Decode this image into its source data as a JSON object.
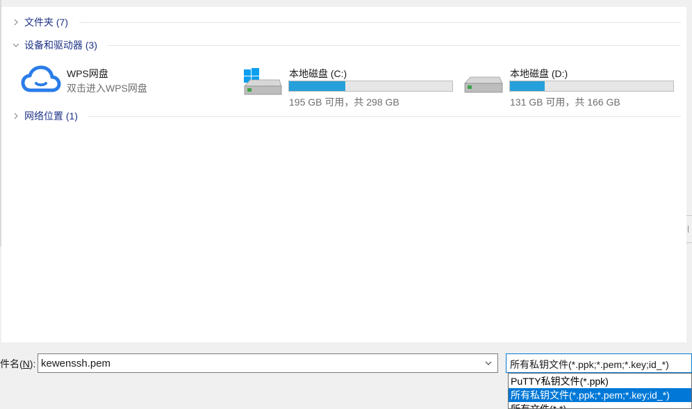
{
  "groups": {
    "folders": {
      "label": "文件夹 (7)"
    },
    "devices": {
      "label": "设备和驱动器 (3)"
    },
    "network": {
      "label": "网络位置 (1)"
    }
  },
  "devices": {
    "wps": {
      "name": "WPS网盘",
      "subtitle": "双击进入WPS网盘"
    },
    "drive_c": {
      "name": "本地磁盘 (C:)",
      "space": "195 GB 可用，共 298 GB",
      "used_fraction": 0.346
    },
    "drive_d": {
      "name": "本地磁盘 (D:)",
      "space": "131 GB 可用，共 166 GB",
      "used_fraction": 0.211
    }
  },
  "bottom": {
    "filename_label": "件名(",
    "filename_hotkey": "N",
    "filename_label_end": "):",
    "filename_value": "kewenssh.pem",
    "filetype_selected": "所有私钥文件(*.ppk;*.pem;*.key;id_*)",
    "filetype_options": [
      "PuTTY私钥文件(*.ppk)",
      "所有私钥文件(*.ppk;*.pem;*.key;id_*)",
      "所有文件(*.*)"
    ]
  },
  "colors": {
    "accent": "#0078d7",
    "drive_bar": "#26a0da",
    "group_title": "#1e3287"
  }
}
